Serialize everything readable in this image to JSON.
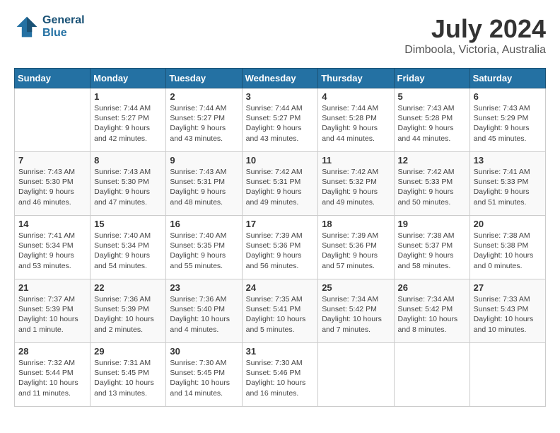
{
  "header": {
    "logo_line1": "General",
    "logo_line2": "Blue",
    "title": "July 2024",
    "subtitle": "Dimboola, Victoria, Australia"
  },
  "weekdays": [
    "Sunday",
    "Monday",
    "Tuesday",
    "Wednesday",
    "Thursday",
    "Friday",
    "Saturday"
  ],
  "weeks": [
    [
      {
        "day": "",
        "info": ""
      },
      {
        "day": "1",
        "info": "Sunrise: 7:44 AM\nSunset: 5:27 PM\nDaylight: 9 hours\nand 42 minutes."
      },
      {
        "day": "2",
        "info": "Sunrise: 7:44 AM\nSunset: 5:27 PM\nDaylight: 9 hours\nand 43 minutes."
      },
      {
        "day": "3",
        "info": "Sunrise: 7:44 AM\nSunset: 5:27 PM\nDaylight: 9 hours\nand 43 minutes."
      },
      {
        "day": "4",
        "info": "Sunrise: 7:44 AM\nSunset: 5:28 PM\nDaylight: 9 hours\nand 44 minutes."
      },
      {
        "day": "5",
        "info": "Sunrise: 7:43 AM\nSunset: 5:28 PM\nDaylight: 9 hours\nand 44 minutes."
      },
      {
        "day": "6",
        "info": "Sunrise: 7:43 AM\nSunset: 5:29 PM\nDaylight: 9 hours\nand 45 minutes."
      }
    ],
    [
      {
        "day": "7",
        "info": "Sunrise: 7:43 AM\nSunset: 5:30 PM\nDaylight: 9 hours\nand 46 minutes."
      },
      {
        "day": "8",
        "info": "Sunrise: 7:43 AM\nSunset: 5:30 PM\nDaylight: 9 hours\nand 47 minutes."
      },
      {
        "day": "9",
        "info": "Sunrise: 7:43 AM\nSunset: 5:31 PM\nDaylight: 9 hours\nand 48 minutes."
      },
      {
        "day": "10",
        "info": "Sunrise: 7:42 AM\nSunset: 5:31 PM\nDaylight: 9 hours\nand 49 minutes."
      },
      {
        "day": "11",
        "info": "Sunrise: 7:42 AM\nSunset: 5:32 PM\nDaylight: 9 hours\nand 49 minutes."
      },
      {
        "day": "12",
        "info": "Sunrise: 7:42 AM\nSunset: 5:33 PM\nDaylight: 9 hours\nand 50 minutes."
      },
      {
        "day": "13",
        "info": "Sunrise: 7:41 AM\nSunset: 5:33 PM\nDaylight: 9 hours\nand 51 minutes."
      }
    ],
    [
      {
        "day": "14",
        "info": "Sunrise: 7:41 AM\nSunset: 5:34 PM\nDaylight: 9 hours\nand 53 minutes."
      },
      {
        "day": "15",
        "info": "Sunrise: 7:40 AM\nSunset: 5:34 PM\nDaylight: 9 hours\nand 54 minutes."
      },
      {
        "day": "16",
        "info": "Sunrise: 7:40 AM\nSunset: 5:35 PM\nDaylight: 9 hours\nand 55 minutes."
      },
      {
        "day": "17",
        "info": "Sunrise: 7:39 AM\nSunset: 5:36 PM\nDaylight: 9 hours\nand 56 minutes."
      },
      {
        "day": "18",
        "info": "Sunrise: 7:39 AM\nSunset: 5:36 PM\nDaylight: 9 hours\nand 57 minutes."
      },
      {
        "day": "19",
        "info": "Sunrise: 7:38 AM\nSunset: 5:37 PM\nDaylight: 9 hours\nand 58 minutes."
      },
      {
        "day": "20",
        "info": "Sunrise: 7:38 AM\nSunset: 5:38 PM\nDaylight: 10 hours\nand 0 minutes."
      }
    ],
    [
      {
        "day": "21",
        "info": "Sunrise: 7:37 AM\nSunset: 5:39 PM\nDaylight: 10 hours\nand 1 minute."
      },
      {
        "day": "22",
        "info": "Sunrise: 7:36 AM\nSunset: 5:39 PM\nDaylight: 10 hours\nand 2 minutes."
      },
      {
        "day": "23",
        "info": "Sunrise: 7:36 AM\nSunset: 5:40 PM\nDaylight: 10 hours\nand 4 minutes."
      },
      {
        "day": "24",
        "info": "Sunrise: 7:35 AM\nSunset: 5:41 PM\nDaylight: 10 hours\nand 5 minutes."
      },
      {
        "day": "25",
        "info": "Sunrise: 7:34 AM\nSunset: 5:42 PM\nDaylight: 10 hours\nand 7 minutes."
      },
      {
        "day": "26",
        "info": "Sunrise: 7:34 AM\nSunset: 5:42 PM\nDaylight: 10 hours\nand 8 minutes."
      },
      {
        "day": "27",
        "info": "Sunrise: 7:33 AM\nSunset: 5:43 PM\nDaylight: 10 hours\nand 10 minutes."
      }
    ],
    [
      {
        "day": "28",
        "info": "Sunrise: 7:32 AM\nSunset: 5:44 PM\nDaylight: 10 hours\nand 11 minutes."
      },
      {
        "day": "29",
        "info": "Sunrise: 7:31 AM\nSunset: 5:45 PM\nDaylight: 10 hours\nand 13 minutes."
      },
      {
        "day": "30",
        "info": "Sunrise: 7:30 AM\nSunset: 5:45 PM\nDaylight: 10 hours\nand 14 minutes."
      },
      {
        "day": "31",
        "info": "Sunrise: 7:30 AM\nSunset: 5:46 PM\nDaylight: 10 hours\nand 16 minutes."
      },
      {
        "day": "",
        "info": ""
      },
      {
        "day": "",
        "info": ""
      },
      {
        "day": "",
        "info": ""
      }
    ]
  ]
}
